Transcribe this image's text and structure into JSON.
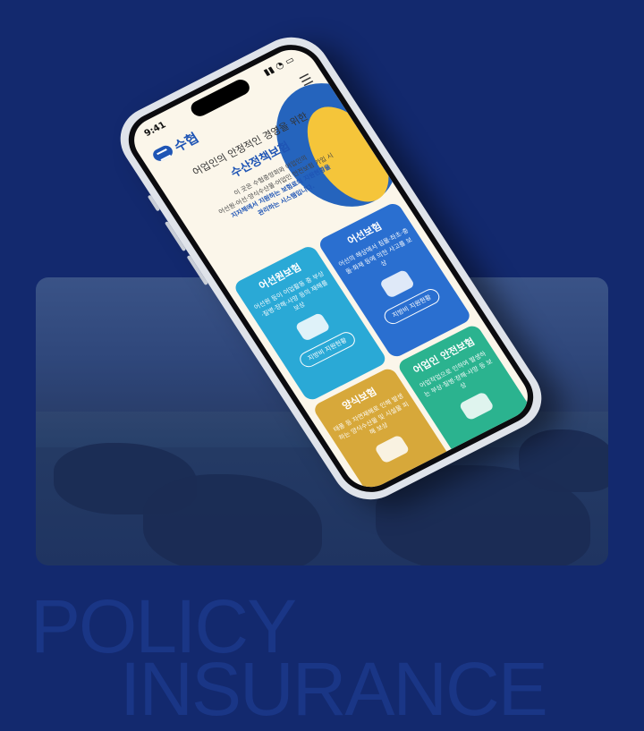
{
  "background_text": {
    "line1": "POLICY",
    "line2": "INSURANCE"
  },
  "phone": {
    "status_time": "9:41",
    "brand": "수협",
    "hero": {
      "subtitle": "어업인의 안정적인 경영을 위한",
      "title": "수산정책보험",
      "desc_line1": "이 곳은 수협중앙회와 어업인의",
      "desc_line2": "어선원·어선·양식수산물·어업인 안전보험 가입 시",
      "desc_line3": "지자체에서 지원하는 보험료의 지원현황을",
      "desc_line4": "관리하는 시스템입니다."
    },
    "cards": [
      {
        "title": "어선원보험",
        "desc": "어선원 등이 어업활동 중 부상·질병·장해·사망 등의 재해를 보상",
        "button": "지방비 지원현황",
        "color": "#2aa9d6"
      },
      {
        "title": "어선보험",
        "desc": "어선의 해상에서 침몰·좌초·충돌·화재 등에 의한 사고를 보상",
        "button": "지방비 지원현황",
        "color": "#2a6fd0"
      },
      {
        "title": "양식보험",
        "desc": "태풍 등 자연재해로 인해 발생하는 양식수산물 및 시설물 피해 보상",
        "button": "",
        "color": "#d7a83a"
      },
      {
        "title": "어업인 안전보험",
        "desc": "어업작업으로 인하여 발생하는 부상·질병·장해·사망 등 보상",
        "button": "",
        "color": "#2bb38f"
      }
    ]
  }
}
